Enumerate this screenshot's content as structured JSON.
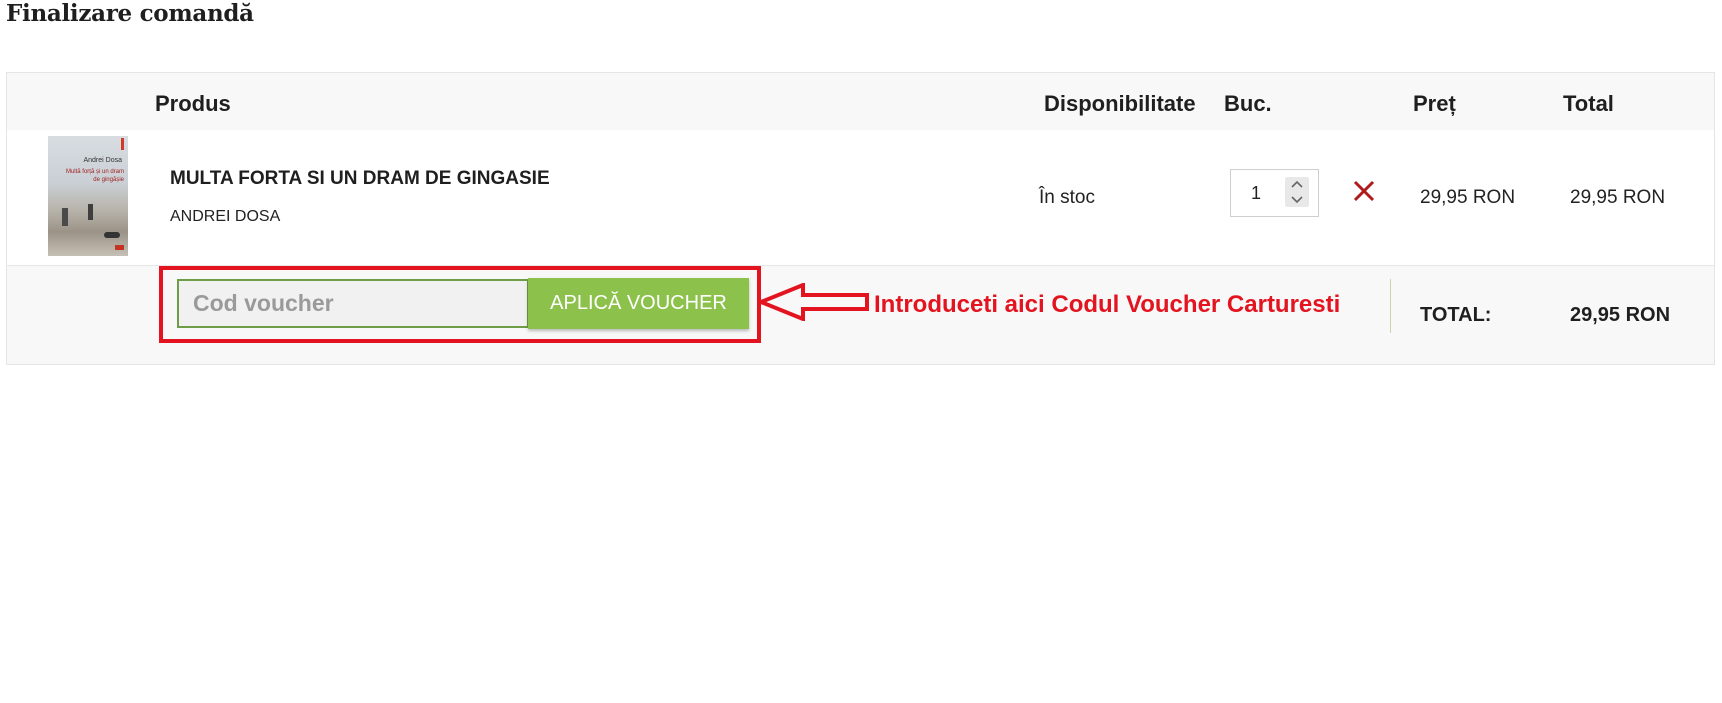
{
  "page": {
    "title": "Finalizare comandă"
  },
  "table": {
    "headers": {
      "product": "Produs",
      "availability": "Disponibilitate",
      "quantity": "Buc.",
      "price": "Preț",
      "total": "Total"
    },
    "items": [
      {
        "title": "MULTA FORTA SI UN DRAM DE GINGASIE",
        "author": "ANDREI DOSA",
        "availability": "În stoc",
        "quantity": "1",
        "price": "29,95 RON",
        "total": "29,95 RON",
        "cover": {
          "author": "Andrei Dosa",
          "title": "Multă forță și un dram de gingășie"
        }
      }
    ]
  },
  "voucher": {
    "placeholder": "Cod voucher",
    "button_label": "APLICĂ VOUCHER"
  },
  "annotation": {
    "text": "Introduceti aici Codul Voucher Carturesti",
    "color": "#e3141f"
  },
  "summary": {
    "total_label": "TOTAL:",
    "total_value": "29,95 RON"
  },
  "colors": {
    "accent_green": "#8cc24b",
    "input_border": "#6e9d47",
    "remove_red": "#b01a1a"
  }
}
